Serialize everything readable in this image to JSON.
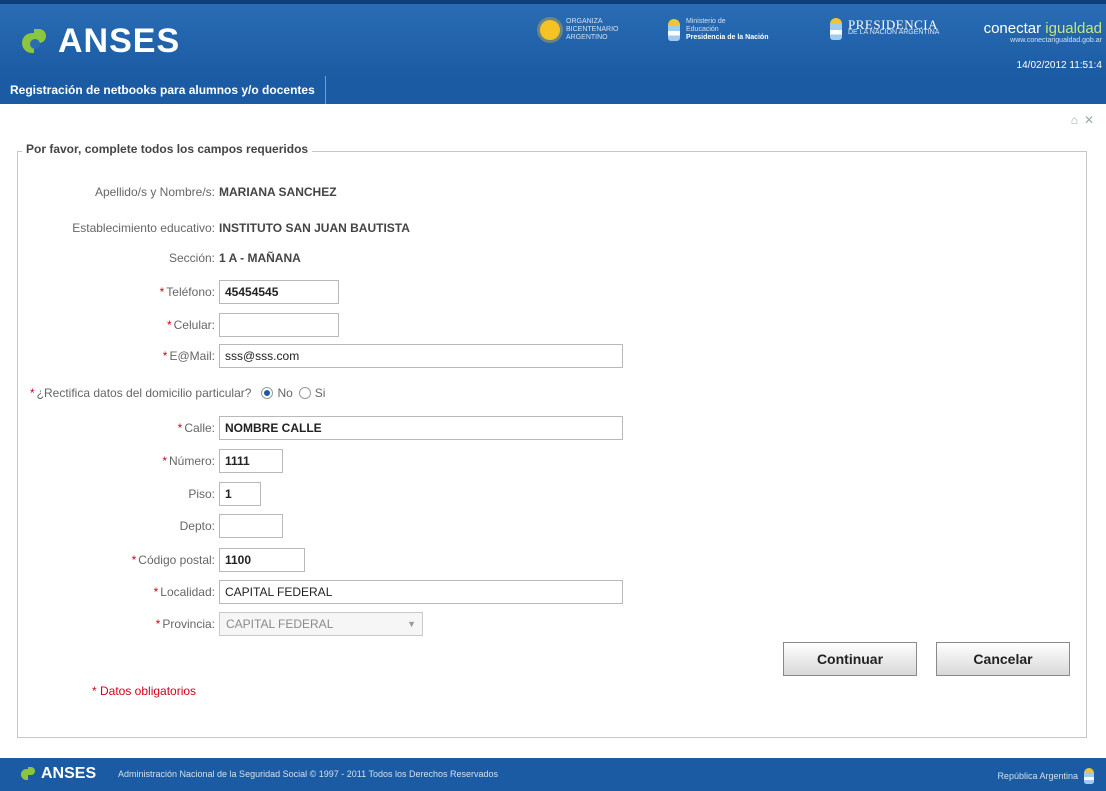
{
  "header": {
    "logo_text": "ANSES",
    "sponsor1": [
      "ORGANIZA",
      "BICENTENARIO",
      "ARGENTINO"
    ],
    "sponsor2": [
      "Ministerio de",
      "Educación",
      "Presidencia de la Nación"
    ],
    "presidencia": "PRESIDENCIA",
    "presidencia_sub": "DE LA NACIÓN ARGENTINA",
    "conectar": "conectar",
    "igualdad": "igualdad",
    "conectar_url": "www.conectarigualdad.gob.ar",
    "datetime": "14/02/2012 11:51:4"
  },
  "subheader": {
    "tab": "Registración de netbooks para alumnos y/o docentes"
  },
  "form": {
    "legend": "Por favor, complete todos los campos requeridos",
    "apellidos": {
      "label": "Apellido/s y Nombre/s:",
      "value": "MARIANA SANCHEZ"
    },
    "establecimiento": {
      "label": "Establecimiento educativo:",
      "value": "INSTITUTO SAN JUAN BAUTISTA"
    },
    "seccion": {
      "label": "Sección:",
      "value": "1 A - MAÑANA"
    },
    "telefono": {
      "label": "Teléfono:",
      "value": "45454545"
    },
    "celular": {
      "label": "Celular:",
      "value": ""
    },
    "email": {
      "label": "E@Mail:",
      "value": "sss@sss.com"
    },
    "rectifica": {
      "label": "¿Rectifica datos del domicilio particular?",
      "opt_no": "No",
      "opt_si": "Si",
      "selected": "No"
    },
    "calle": {
      "label": "Calle:",
      "value": "NOMBRE CALLE"
    },
    "numero": {
      "label": "Número:",
      "value": "1111"
    },
    "piso": {
      "label": "Piso:",
      "value": "1"
    },
    "depto": {
      "label": "Depto:",
      "value": ""
    },
    "codigo_postal": {
      "label": "Código postal:",
      "value": "1100"
    },
    "localidad": {
      "label": "Localidad:",
      "value": "CAPITAL FEDERAL"
    },
    "provincia": {
      "label": "Provincia:",
      "value": "CAPITAL FEDERAL"
    },
    "required_mark": "*",
    "obligatorios": "* Datos obligatorios",
    "continuar": "Continuar",
    "cancelar": "Cancelar"
  },
  "footer": {
    "logo_text": "ANSES",
    "text": "Administración Nacional de la Seguridad Social © 1997 - 2011 Todos los Derechos Reservados",
    "right": "República Argentina"
  },
  "colors": {
    "brand_blue": "#1b5ba3",
    "brand_green": "#8cc63f",
    "required_red": "#d0021b"
  }
}
